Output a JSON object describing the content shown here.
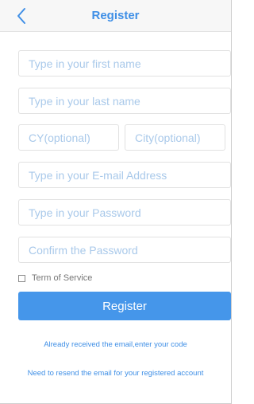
{
  "nav": {
    "title": "Register",
    "back_icon": "chevron-left-icon",
    "accent_color": "#3f8fe6"
  },
  "form": {
    "first_name_placeholder": "Type in your first name",
    "last_name_placeholder": "Type in your last name",
    "cy_placeholder": "CY(optional)",
    "city_placeholder": "City(optional)",
    "email_placeholder": "Type in your E-mail Address",
    "password_placeholder": "Type in your Password",
    "confirm_placeholder": "Confirm the Password",
    "first_name_value": "",
    "last_name_value": "",
    "cy_value": "",
    "city_value": "",
    "email_value": "",
    "password_value": "",
    "confirm_value": ""
  },
  "terms": {
    "label": "Term of Service",
    "checked": false
  },
  "actions": {
    "register_label": "Register",
    "button_color": "#4596ea"
  },
  "links": {
    "code_link": "Already received the email,enter your code",
    "resend_link": "Need to resend the email for your registered account"
  }
}
